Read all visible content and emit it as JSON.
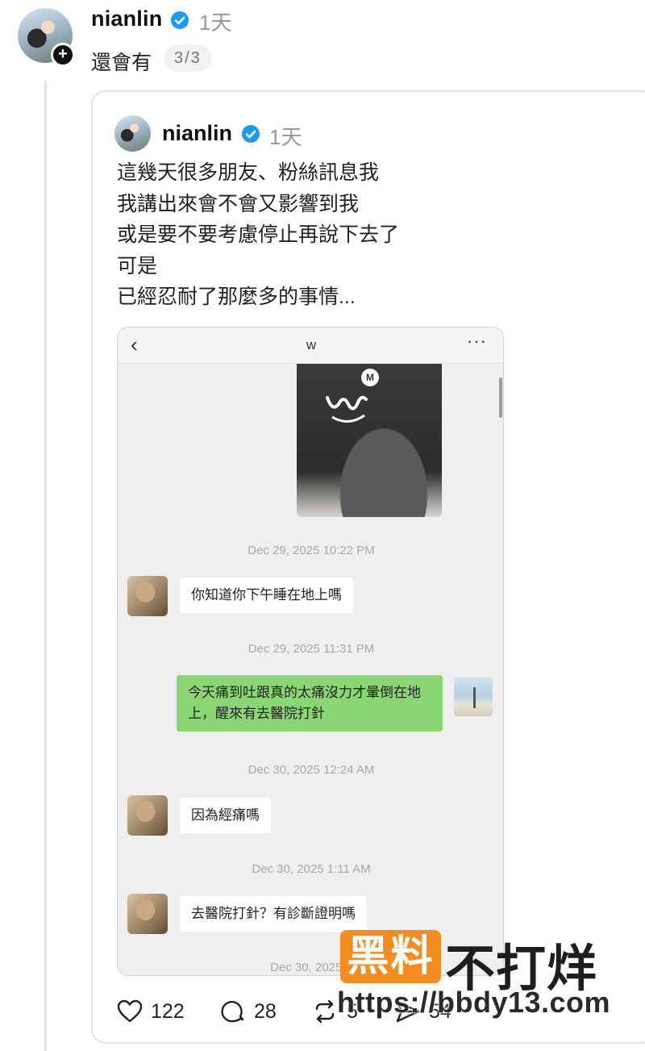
{
  "post": {
    "username": "nianlin",
    "time": "1天",
    "text": "還會有",
    "page_indicator": "3/3",
    "follow_icon": "plus-icon"
  },
  "quote": {
    "username": "nianlin",
    "time": "1天",
    "lines": [
      "這幾天很多朋友、粉絲訊息我",
      "我講出來會不會又影響到我",
      "或是要不要考慮停止再說下去了",
      "可是",
      "已經忍耐了那麼多的事情..."
    ]
  },
  "chat": {
    "back_icon": "‹",
    "title": "w",
    "more_icon": "···",
    "photo_logo_badge": "M",
    "messages": [
      {
        "timestamp": "Dec 29, 2025 10:22 PM",
        "side": "left",
        "text": "你知道你下午睡在地上嗎"
      },
      {
        "timestamp": "Dec 29, 2025 11:31 PM",
        "side": "right",
        "text": "今天痛到吐跟真的太痛沒力才暈倒在地上，醒來有去醫院打針"
      },
      {
        "timestamp": "Dec 30, 2025 12:24 AM",
        "side": "left",
        "text": "因為經痛嗎"
      },
      {
        "timestamp": "Dec 30, 2025 1:11 AM",
        "side": "left",
        "text": "去醫院打針？有診斷證明嗎"
      },
      {
        "timestamp": "Dec 30, 2025 1",
        "side": "left",
        "text": ""
      }
    ]
  },
  "actions": {
    "likes": "122",
    "comments": "28",
    "reposts": "5",
    "shares": "54"
  },
  "watermark": {
    "badge": "黑料",
    "text": "不打烊",
    "url": "https://bbdy13.com",
    "badge_color": "#f28d22"
  },
  "colors": {
    "verified": "#1d9bf0",
    "bubble_right": "#8bd674",
    "timestamp": "#a9a9a9"
  }
}
